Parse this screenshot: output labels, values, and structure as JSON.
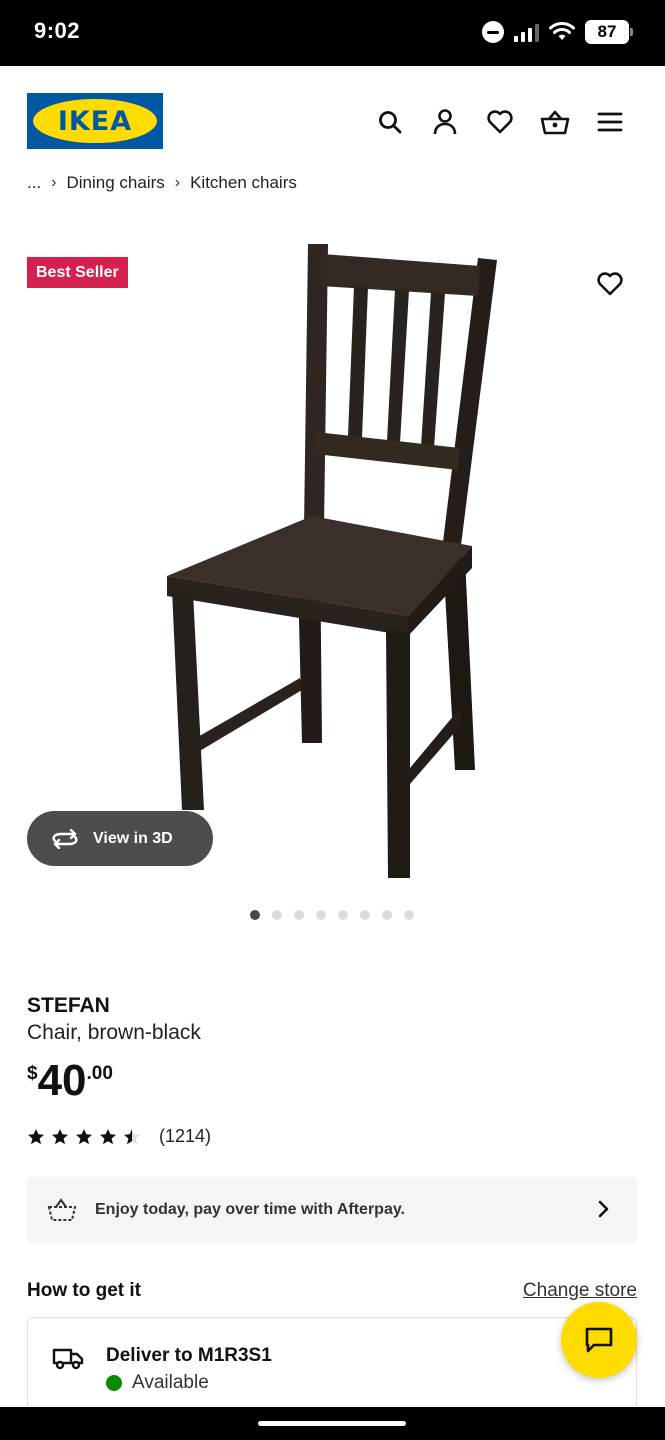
{
  "status_bar": {
    "time": "9:02",
    "battery": "87"
  },
  "header": {
    "logo_text": "IKEA",
    "icons": [
      "search-icon",
      "account-icon",
      "heart-icon",
      "basket-icon",
      "menu-icon"
    ]
  },
  "breadcrumb": {
    "ellipsis": "...",
    "items": [
      "Dining chairs",
      "Kitchen chairs"
    ]
  },
  "product_image": {
    "badge": "Best Seller",
    "view_3d_label": "View in 3D",
    "carousel_dots": 8,
    "active_dot": 0
  },
  "product": {
    "name": "STEFAN",
    "description": "Chair, brown-black",
    "price_currency": "$",
    "price_whole": "40",
    "price_cents": ".00",
    "rating": 4.5,
    "rating_max": 5,
    "rating_count": "(1214)"
  },
  "afterpay": {
    "text": "Enjoy today, pay over time with Afterpay."
  },
  "how_to_get": {
    "title": "How to get it",
    "change_store": "Change store",
    "delivery_title": "Deliver to M1R3S1",
    "delivery_status": "Available"
  },
  "colors": {
    "ikea_blue": "#0058a3",
    "ikea_yellow": "#ffdb00",
    "badge_red": "#d4214f",
    "available_green": "#0a8a00"
  }
}
